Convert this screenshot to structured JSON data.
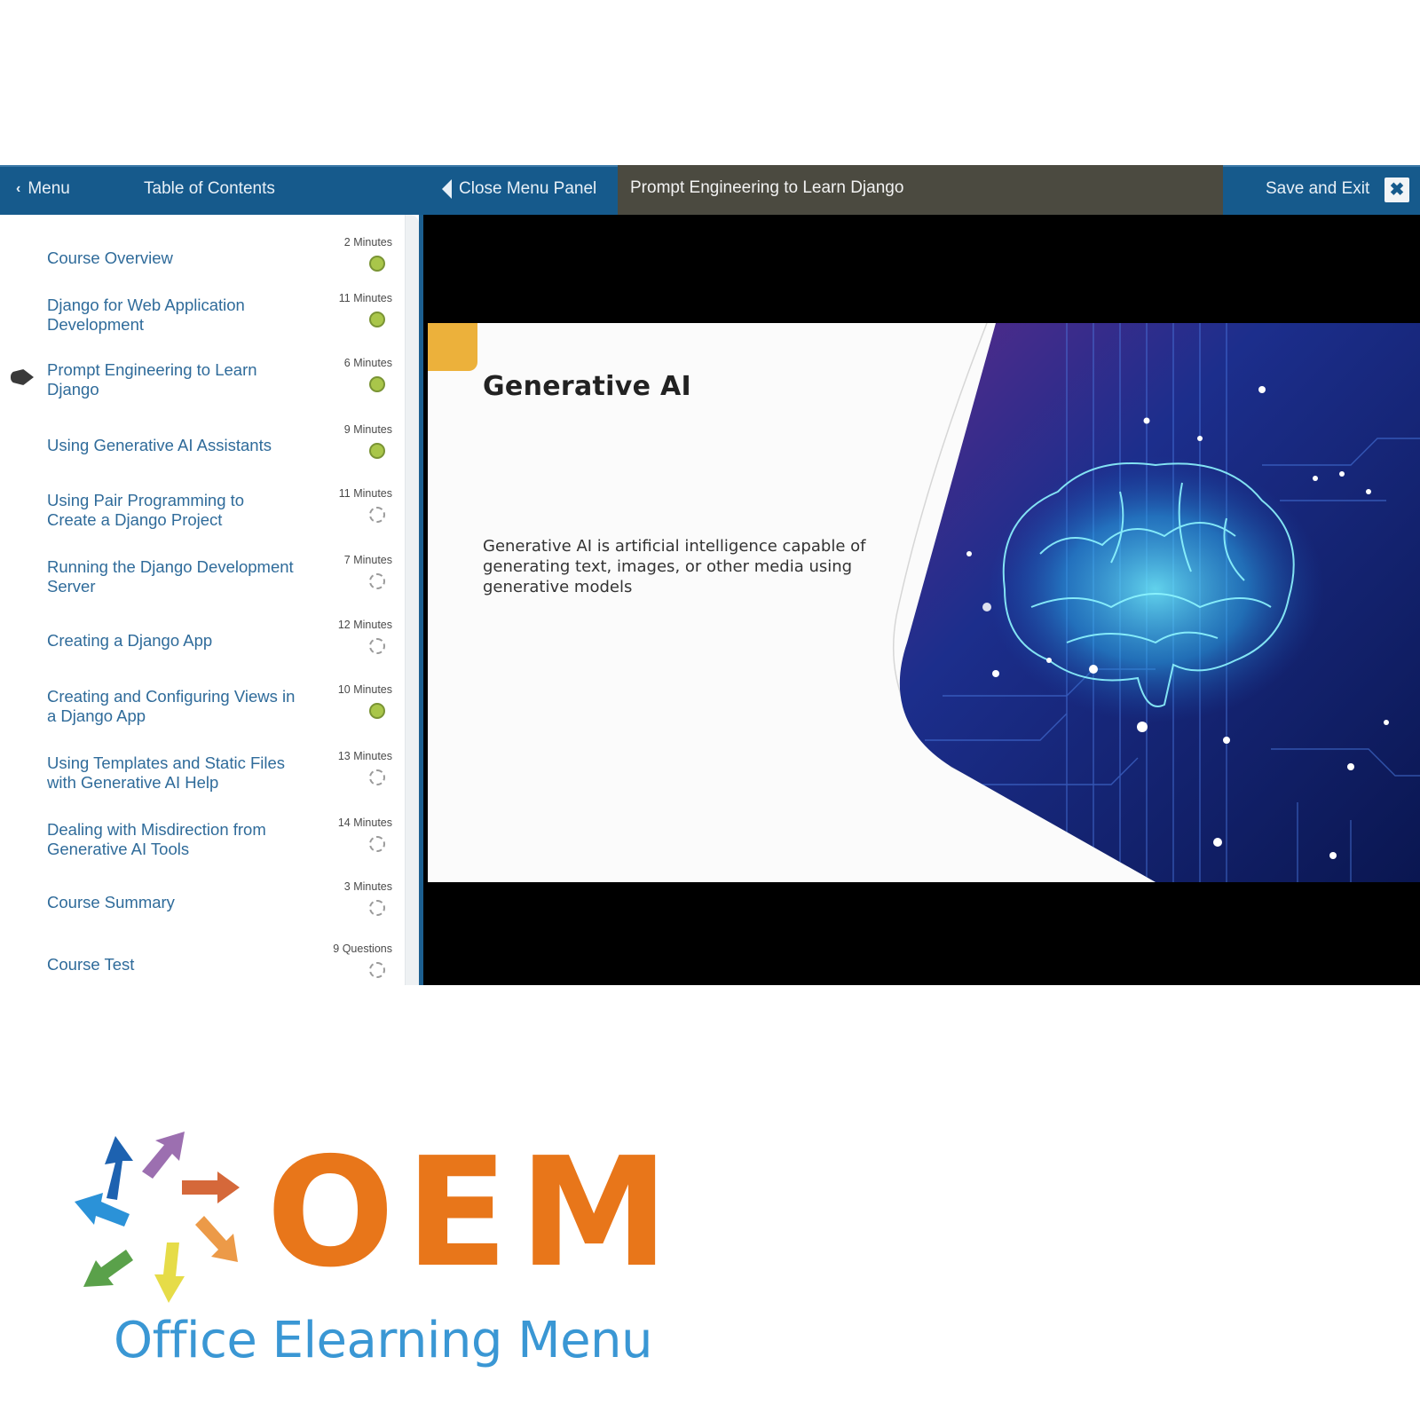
{
  "topbar": {
    "menu_label": "Menu",
    "toc_title": "Table of Contents",
    "close_panel_label": "Close Menu Panel",
    "lesson_title": "Prompt Engineering to Learn Django",
    "save_exit_label": "Save and Exit",
    "close_icon": "✖"
  },
  "toc": {
    "current_index": 2,
    "items": [
      {
        "label": "Course Overview",
        "duration": "2 Minutes",
        "status": "complete"
      },
      {
        "label": "Django for Web Application Development",
        "duration": "11 Minutes",
        "status": "complete"
      },
      {
        "label": "Prompt Engineering to Learn Django",
        "duration": "6 Minutes",
        "status": "complete"
      },
      {
        "label": "Using Generative AI Assistants",
        "duration": "9 Minutes",
        "status": "complete"
      },
      {
        "label": "Using Pair Programming to Create a Django Project",
        "duration": "11 Minutes",
        "status": "not-started"
      },
      {
        "label": "Running the Django Development Server",
        "duration": "7 Minutes",
        "status": "not-started"
      },
      {
        "label": "Creating a Django App",
        "duration": "12 Minutes",
        "status": "not-started"
      },
      {
        "label": "Creating and Configuring Views in a Django App",
        "duration": "10 Minutes",
        "status": "complete"
      },
      {
        "label": "Using Templates and Static Files with Generative AI Help",
        "duration": "13 Minutes",
        "status": "not-started"
      },
      {
        "label": "Dealing with Misdirection from Generative AI Tools",
        "duration": "14 Minutes",
        "status": "not-started"
      },
      {
        "label": "Course Summary",
        "duration": "3 Minutes",
        "status": "not-started"
      },
      {
        "label": "Course Test",
        "duration": "9 Questions",
        "status": "not-started"
      }
    ]
  },
  "slide": {
    "title": "Generative AI",
    "body": "Generative AI is artificial intelligence capable of generating text, images, or other media using generative models",
    "image_subject": "glowing-brain-circuit-board"
  },
  "logo": {
    "wordmark": "OEM",
    "tagline": "Office Elearning Menu"
  },
  "colors": {
    "header_blue": "#165a8c",
    "header_dark": "#4b4a40",
    "link_blue": "#2f6b9a",
    "complete_green": "#a9c64a",
    "accent_yellow": "#ecb13b",
    "logo_orange": "#e8761a",
    "logo_blue": "#3a97d4"
  }
}
